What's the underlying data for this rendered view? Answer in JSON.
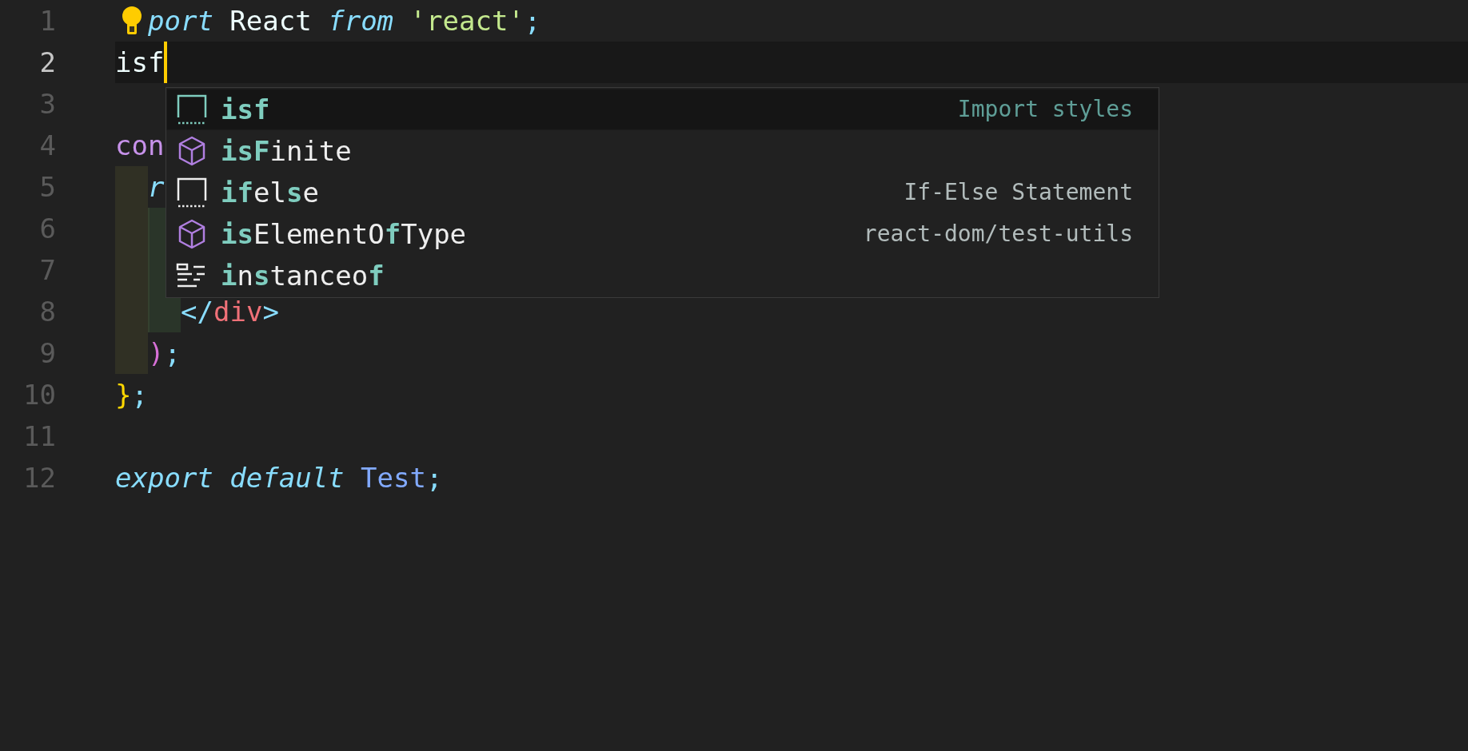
{
  "editor": {
    "lines": [
      {
        "number": "1",
        "current": false,
        "lightbulb": true,
        "tokens": [
          {
            "text": "port",
            "kind": "keyword"
          },
          {
            "text": " React ",
            "kind": "plain"
          },
          {
            "text": "from",
            "kind": "keyword"
          },
          {
            "text": " 'react'",
            "kind": "string"
          },
          {
            "text": ";",
            "kind": "punct"
          }
        ]
      },
      {
        "number": "2",
        "current": true,
        "tokens": [
          {
            "text": "isf",
            "kind": "plain"
          }
        ]
      },
      {
        "number": "3",
        "current": false
      },
      {
        "number": "4",
        "current": false,
        "tokens": [
          {
            "text": "con",
            "kind": "storage"
          }
        ]
      },
      {
        "number": "5",
        "current": false,
        "guides": [
          {
            "kind": "outer"
          }
        ],
        "tokens": [
          {
            "text": "r",
            "kind": "keyword"
          }
        ]
      },
      {
        "number": "6",
        "current": false,
        "guides": [
          {
            "kind": "outer"
          },
          {
            "kind": "inner"
          }
        ]
      },
      {
        "number": "7",
        "current": false,
        "guides": [
          {
            "kind": "outer"
          },
          {
            "kind": "inner"
          }
        ]
      },
      {
        "number": "8",
        "current": false,
        "guides": [
          {
            "kind": "outer"
          },
          {
            "kind": "inner"
          }
        ],
        "tokens": [
          {
            "text": "</",
            "kind": "punct"
          },
          {
            "text": "div",
            "kind": "tag"
          },
          {
            "text": ">",
            "kind": "punct"
          }
        ]
      },
      {
        "number": "9",
        "current": false,
        "guides": [
          {
            "kind": "outer"
          }
        ],
        "tokens": [
          {
            "text": ")",
            "kind": "paren"
          },
          {
            "text": ";",
            "kind": "punct"
          }
        ]
      },
      {
        "number": "10",
        "current": false,
        "tokens": [
          {
            "text": "}",
            "kind": "brace"
          },
          {
            "text": ";",
            "kind": "punct"
          }
        ]
      },
      {
        "number": "11",
        "current": false
      },
      {
        "number": "12",
        "current": false,
        "tokens": [
          {
            "text": "export default",
            "kind": "keyword"
          },
          {
            "text": " Test",
            "kind": "class"
          },
          {
            "text": ";",
            "kind": "punct"
          }
        ]
      }
    ]
  },
  "suggestions": [
    {
      "kind": "snippet",
      "selected": true,
      "label": [
        {
          "text": "isf",
          "match": true
        }
      ],
      "detail": "Import styles"
    },
    {
      "kind": "module",
      "selected": false,
      "label": [
        {
          "text": "isF",
          "match": true
        },
        {
          "text": "inite",
          "match": false
        }
      ]
    },
    {
      "kind": "snippet",
      "selected": false,
      "label": [
        {
          "text": "if",
          "match": true
        },
        {
          "text": "el",
          "match": false
        },
        {
          "text": "s",
          "match": true
        },
        {
          "text": "e",
          "match": false
        }
      ],
      "detail": "If-Else Statement"
    },
    {
      "kind": "module",
      "selected": false,
      "label": [
        {
          "text": "is",
          "match": true
        },
        {
          "text": "ElementO",
          "match": false
        },
        {
          "text": "f",
          "match": true
        },
        {
          "text": "Type",
          "match": false
        }
      ],
      "detail": "react-dom/test-utils"
    },
    {
      "kind": "keyword",
      "selected": false,
      "label": [
        {
          "text": "i",
          "match": true
        },
        {
          "text": "n",
          "match": false
        },
        {
          "text": "s",
          "match": true
        },
        {
          "text": "tanceo",
          "match": false
        },
        {
          "text": "f",
          "match": true
        }
      ]
    }
  ]
}
